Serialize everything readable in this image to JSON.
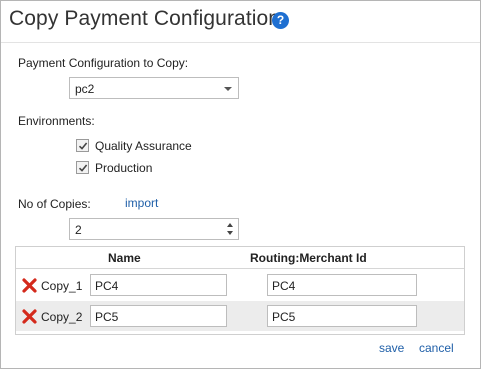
{
  "dialog": {
    "title": "Copy Payment Configuration",
    "help_icon": "help-icon"
  },
  "config": {
    "label": "Payment Configuration to Copy:",
    "selected": "pc2"
  },
  "environments": {
    "label": "Environments:",
    "options": [
      {
        "label": "Quality Assurance",
        "checked": true
      },
      {
        "label": "Production",
        "checked": true
      }
    ]
  },
  "copies": {
    "label": "No of Copies:",
    "import_label": "import",
    "value": "2"
  },
  "grid": {
    "columns": [
      "Name",
      "Routing:Merchant Id"
    ],
    "rows": [
      {
        "label": "Copy_1",
        "name": "PC4",
        "routing": "PC4"
      },
      {
        "label": "Copy_2",
        "name": "PC5",
        "routing": "PC5"
      }
    ]
  },
  "footer": {
    "save_label": "save",
    "cancel_label": "cancel"
  },
  "colors": {
    "link": "#1f5fa8",
    "help_icon_bg": "#1e6fd1",
    "delete_icon": "#d42a1c"
  }
}
